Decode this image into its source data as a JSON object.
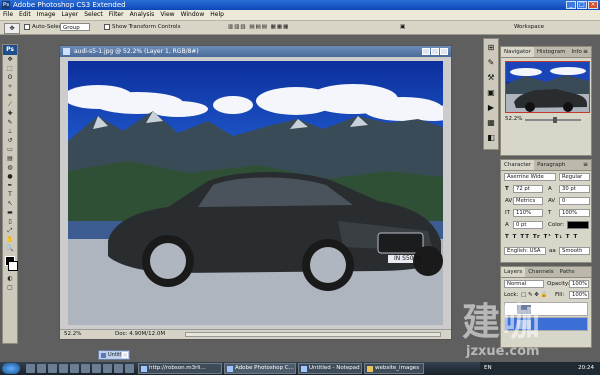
{
  "app": {
    "title": "Adobe Photoshop CS3 Extended",
    "icon_letters": "Ps"
  },
  "menu": [
    "File",
    "Edit",
    "Image",
    "Layer",
    "Select",
    "Filter",
    "Analysis",
    "View",
    "Window",
    "Help"
  ],
  "options_bar": {
    "tool": "move-tool",
    "auto_select_label": "Auto-Select:",
    "auto_select_value": "Group",
    "show_transform_label": "Show Transform Controls",
    "workspace_label": "Workspace"
  },
  "document": {
    "title": "audi-s5-1.jpg @ 52.2% (Layer 1, RGB/8#)",
    "zoom": "52.2%",
    "doc_info": "Doc: 4.90M/12.0M",
    "plate": "IN S5028"
  },
  "navigator": {
    "tabs": [
      "Navigator",
      "Histogram",
      "Info"
    ],
    "zoom": "52.2%"
  },
  "character": {
    "tabs": [
      "Character",
      "Paragraph"
    ],
    "font_family": "Aserrine Wide",
    "font_style": "Regular",
    "size": "72 pt",
    "leading": "30 pt",
    "kerning": "Metrics",
    "tracking": "0",
    "vscale": "110%",
    "hscale": "100%",
    "baseline": "0 pt",
    "color_label": "Color:",
    "language": "English: USA",
    "antialias": "Smooth"
  },
  "layers": {
    "tabs": [
      "Layers",
      "Channels",
      "Paths"
    ],
    "blend_mode": "Normal",
    "opacity_label": "Opacity:",
    "opacity": "100%",
    "lock_label": "Lock:",
    "fill_label": "Fill:",
    "fill": "100%"
  },
  "minimized_doc": {
    "label": "Untitl..."
  },
  "taskbar": {
    "tasks": [
      {
        "label": "http://robson.m3rli..."
      },
      {
        "label": "Adobe Photoshop C..."
      },
      {
        "label": "Untitled - Notepad"
      },
      {
        "label": "website_images"
      }
    ],
    "language": "EN",
    "time": "20:24"
  },
  "watermark": {
    "big": "建咖",
    "url": "jzxue.com"
  },
  "colors": {
    "titlebar": "#0c47b7",
    "panel_bg": "#d8d5c9",
    "workspace_bg": "#5f5f5f",
    "selection": "#3b6fd6"
  }
}
